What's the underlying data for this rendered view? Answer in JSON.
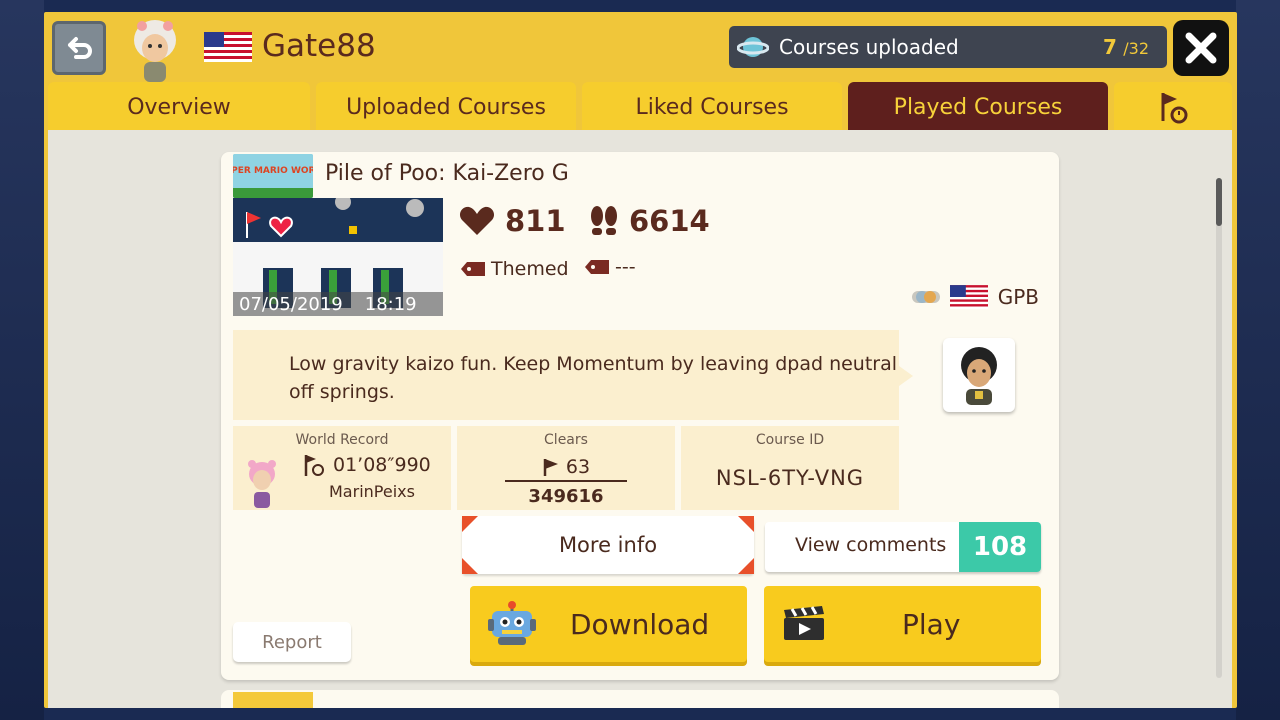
{
  "header": {
    "username": "Gate88",
    "uploaded_label": "Courses uploaded",
    "uploaded_count": "7",
    "uploaded_total": "/32"
  },
  "tabs": [
    {
      "label": "Overview",
      "active": false
    },
    {
      "label": "Uploaded Courses",
      "active": false
    },
    {
      "label": "Liked Courses",
      "active": false
    },
    {
      "label": "Played Courses",
      "active": true
    }
  ],
  "course": {
    "style_logo_text": "SUPER MARIO WORLD",
    "title": "Pile of Poo: Kai-Zero G",
    "likes": "811",
    "plays": "6614",
    "tag1": "Themed",
    "tag2": "---",
    "upload_date": "07/05/2019",
    "upload_time": "18:19",
    "maker_region": "GPB",
    "description": "Low gravity kaizo fun. Keep Momentum by leaving dpad neutral off springs.",
    "world_record_label": "World Record",
    "world_record_time": "01’08″990",
    "world_record_holder": "MarinPeixs",
    "clears_label": "Clears",
    "clears": "63",
    "attempts": "349616",
    "course_id_label": "Course ID",
    "course_id": "NSL-6TY-VNG"
  },
  "buttons": {
    "more_info": "More info",
    "view_comments": "View comments",
    "comment_count": "108",
    "download": "Download",
    "play": "Play",
    "report": "Report"
  },
  "colors": {
    "frame": "#f0c63a",
    "tab_active": "#5e1f1d",
    "comment_count_bg": "#3cc9a8",
    "primary_button": "#f8cb1e"
  },
  "icons": [
    "back-arrow-icon",
    "close-icon",
    "planet-icon",
    "heart-icon",
    "footprints-icon",
    "tag-icon",
    "clear-flag-icon",
    "timer-flag-icon",
    "robot-icon",
    "clapperboard-icon",
    "flag-timer-tab-icon"
  ]
}
